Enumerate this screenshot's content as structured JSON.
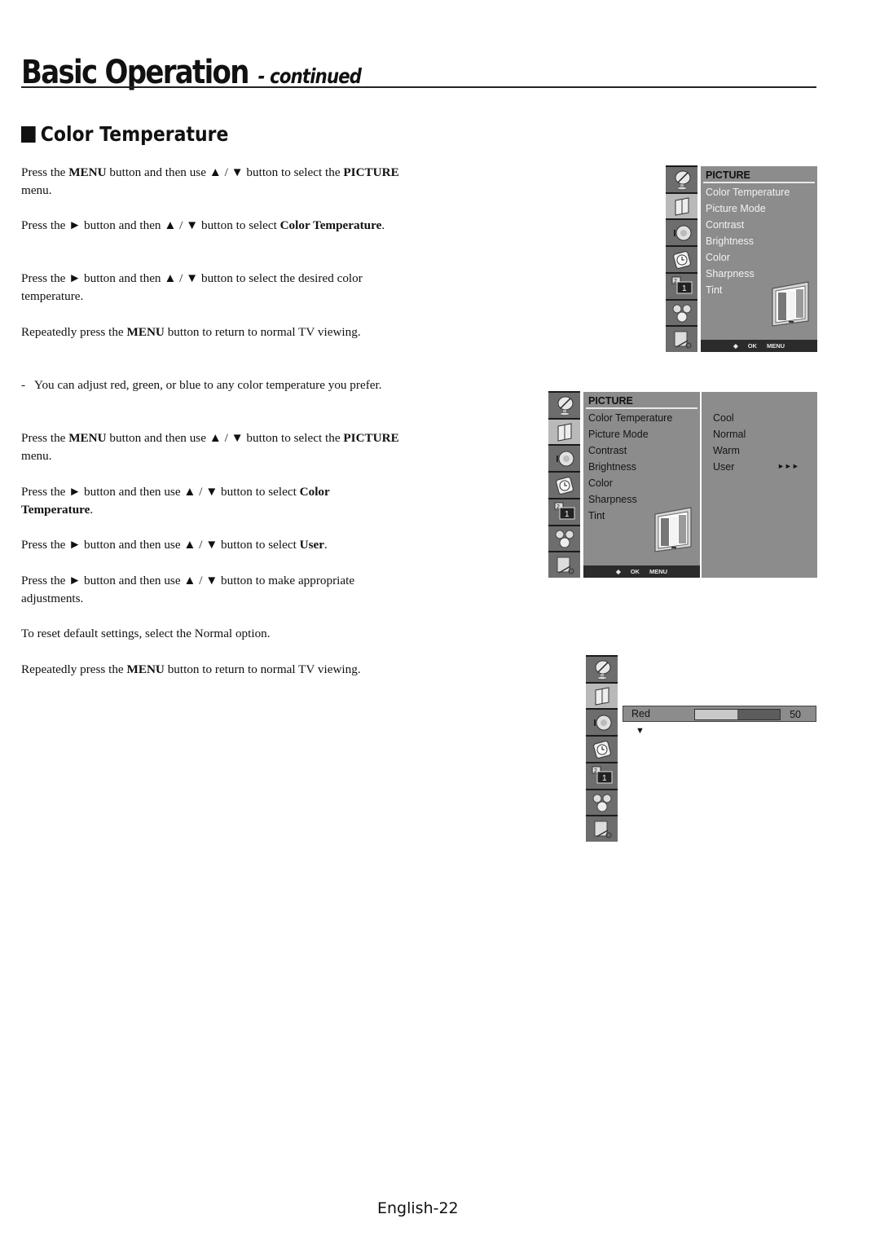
{
  "header": {
    "title": "Basic Operation",
    "subtitle": "- continued"
  },
  "section": {
    "title": "Color Temperature"
  },
  "instructions_a": [
    {
      "parts": [
        [
          "Press the ",
          false
        ],
        [
          "MENU",
          true
        ],
        [
          " button and then use ▲ / ▼ button to select the ",
          false
        ],
        [
          "PICTURE",
          true
        ],
        [
          " menu.",
          false
        ]
      ]
    },
    {
      "parts": [
        [
          "Press the ► button and then ▲ / ▼ button to select ",
          false
        ],
        [
          "Color Temperature",
          true
        ],
        [
          ".",
          false
        ]
      ]
    },
    {
      "parts": [
        [
          "Press the ► button and then ▲ / ▼ button to select the desired color temperature.",
          false
        ]
      ]
    },
    {
      "parts": [
        [
          "Repeatedly press the ",
          false
        ],
        [
          "MENU",
          true
        ],
        [
          " button to return to normal TV viewing.",
          false
        ]
      ]
    }
  ],
  "note": {
    "dash": "-",
    "text": "You can adjust red, green, or blue to any color temperature you prefer."
  },
  "instructions_b": [
    {
      "parts": [
        [
          "Press the ",
          false
        ],
        [
          "MENU",
          true
        ],
        [
          " button and then use ▲ / ▼ button to select the ",
          false
        ],
        [
          "PICTURE",
          true
        ],
        [
          " menu.",
          false
        ]
      ]
    },
    {
      "parts": [
        [
          "Press the ► button and then use ▲ / ▼ button to select ",
          false
        ],
        [
          "Color Temperature",
          true
        ],
        [
          ".",
          false
        ]
      ]
    },
    {
      "parts": [
        [
          "Press the ► button and then use ▲ / ▼ button to select ",
          false
        ],
        [
          "User",
          true
        ],
        [
          ".",
          false
        ]
      ]
    },
    {
      "parts": [
        [
          "Press the ► button and then use ▲ / ▼ button to make appropriate adjustments.",
          false
        ]
      ]
    },
    {
      "parts": [
        [
          "To reset default settings, select the Normal option.",
          false
        ]
      ]
    },
    {
      "parts": [
        [
          "Repeatedly press the ",
          false
        ],
        [
          "MENU",
          true
        ],
        [
          " button to return to normal TV viewing.",
          false
        ]
      ]
    }
  ],
  "osd": {
    "icons": [
      "satellite-dish-icon",
      "picture-icon",
      "speaker-icon",
      "clock-icon",
      "pip-icon",
      "gears-icon",
      "setup-icon"
    ],
    "active_icon": 1,
    "menu_title": "PICTURE",
    "menu_items": [
      "Color Temperature",
      "Picture Mode",
      "Contrast",
      "Brightness",
      "Color",
      "Sharpness",
      "Tint"
    ],
    "footer": {
      "move": "◆",
      "ok": "OK",
      "menu": "MENU"
    },
    "color_temp_options": [
      "Cool",
      "Normal",
      "Warm",
      "User"
    ],
    "user_arrow": "►►►",
    "slider": {
      "label": "Red",
      "value": "50",
      "fraction": 0.5,
      "down_arrow": "▼"
    }
  },
  "footer": {
    "page": "English-22"
  }
}
